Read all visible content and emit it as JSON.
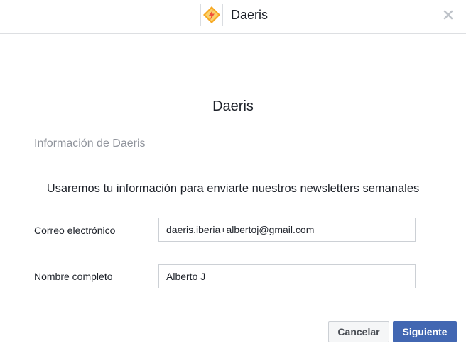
{
  "header": {
    "app_name": "Daeris",
    "logo_icon": "lightning-bolt-icon",
    "close_icon": "close-icon"
  },
  "main": {
    "app_name": "Daeris",
    "section_title": "Información de Daeris",
    "description": "Usaremos tu información para enviarte nuestros newsletters semanales"
  },
  "form": {
    "email": {
      "label": "Correo electrónico",
      "value": "daeris.iberia+albertoj@gmail.com"
    },
    "full_name": {
      "label": "Nombre completo",
      "value": "Alberto J"
    }
  },
  "footer": {
    "cancel_label": "Cancelar",
    "next_label": "Siguiente"
  },
  "colors": {
    "primary_button": "#4267b2",
    "logo_orange": "#f7a823",
    "logo_bolt": "#f0523a"
  }
}
